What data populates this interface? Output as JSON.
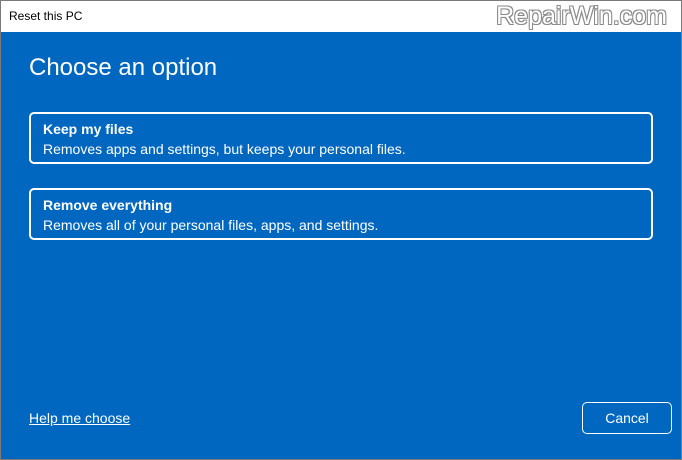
{
  "window": {
    "title": "Reset this PC",
    "watermark": "RepairWin.com"
  },
  "main": {
    "heading": "Choose an option",
    "options": [
      {
        "title": "Keep my files",
        "description": "Removes apps and settings, but keeps your personal files."
      },
      {
        "title": "Remove everything",
        "description": "Removes all of your personal files, apps, and settings."
      }
    ]
  },
  "footer": {
    "help_link": "Help me choose",
    "cancel_label": "Cancel"
  },
  "colors": {
    "background": "#0067c0",
    "titlebar": "#ffffff",
    "text": "#ffffff"
  }
}
